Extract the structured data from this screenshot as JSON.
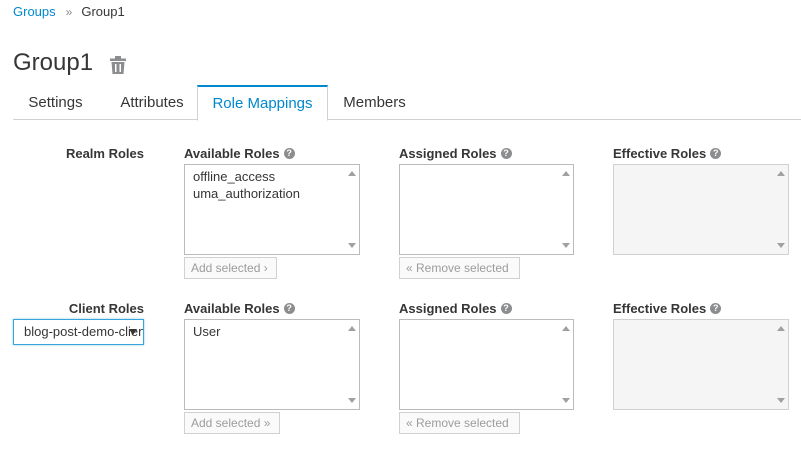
{
  "breadcrumb": {
    "parent": "Groups",
    "separator": "»",
    "current": "Group1"
  },
  "page": {
    "title": "Group1"
  },
  "tabs": [
    {
      "label": "Settings",
      "active": false
    },
    {
      "label": "Attributes",
      "active": false
    },
    {
      "label": "Role Mappings",
      "active": true
    },
    {
      "label": "Members",
      "active": false
    }
  ],
  "realm": {
    "row_label": "Realm Roles",
    "available_label": "Available Roles",
    "assigned_label": "Assigned Roles",
    "effective_label": "Effective Roles",
    "available_items": [
      "offline_access",
      "uma_authorization"
    ],
    "add_button": "Add selected ›",
    "remove_button": "« Remove selected"
  },
  "client": {
    "row_label": "Client Roles",
    "selected_client": "blog-post-demo-client",
    "available_label": "Available Roles",
    "assigned_label": "Assigned Roles",
    "effective_label": "Effective Roles",
    "available_items": [
      "User"
    ],
    "add_button": "Add selected »",
    "remove_button": "« Remove selected"
  },
  "help_glyph": "?",
  "colors": {
    "link": "#0088ce",
    "text": "#363636",
    "border": "#d1d1d1",
    "focus": "#39a5dc"
  }
}
